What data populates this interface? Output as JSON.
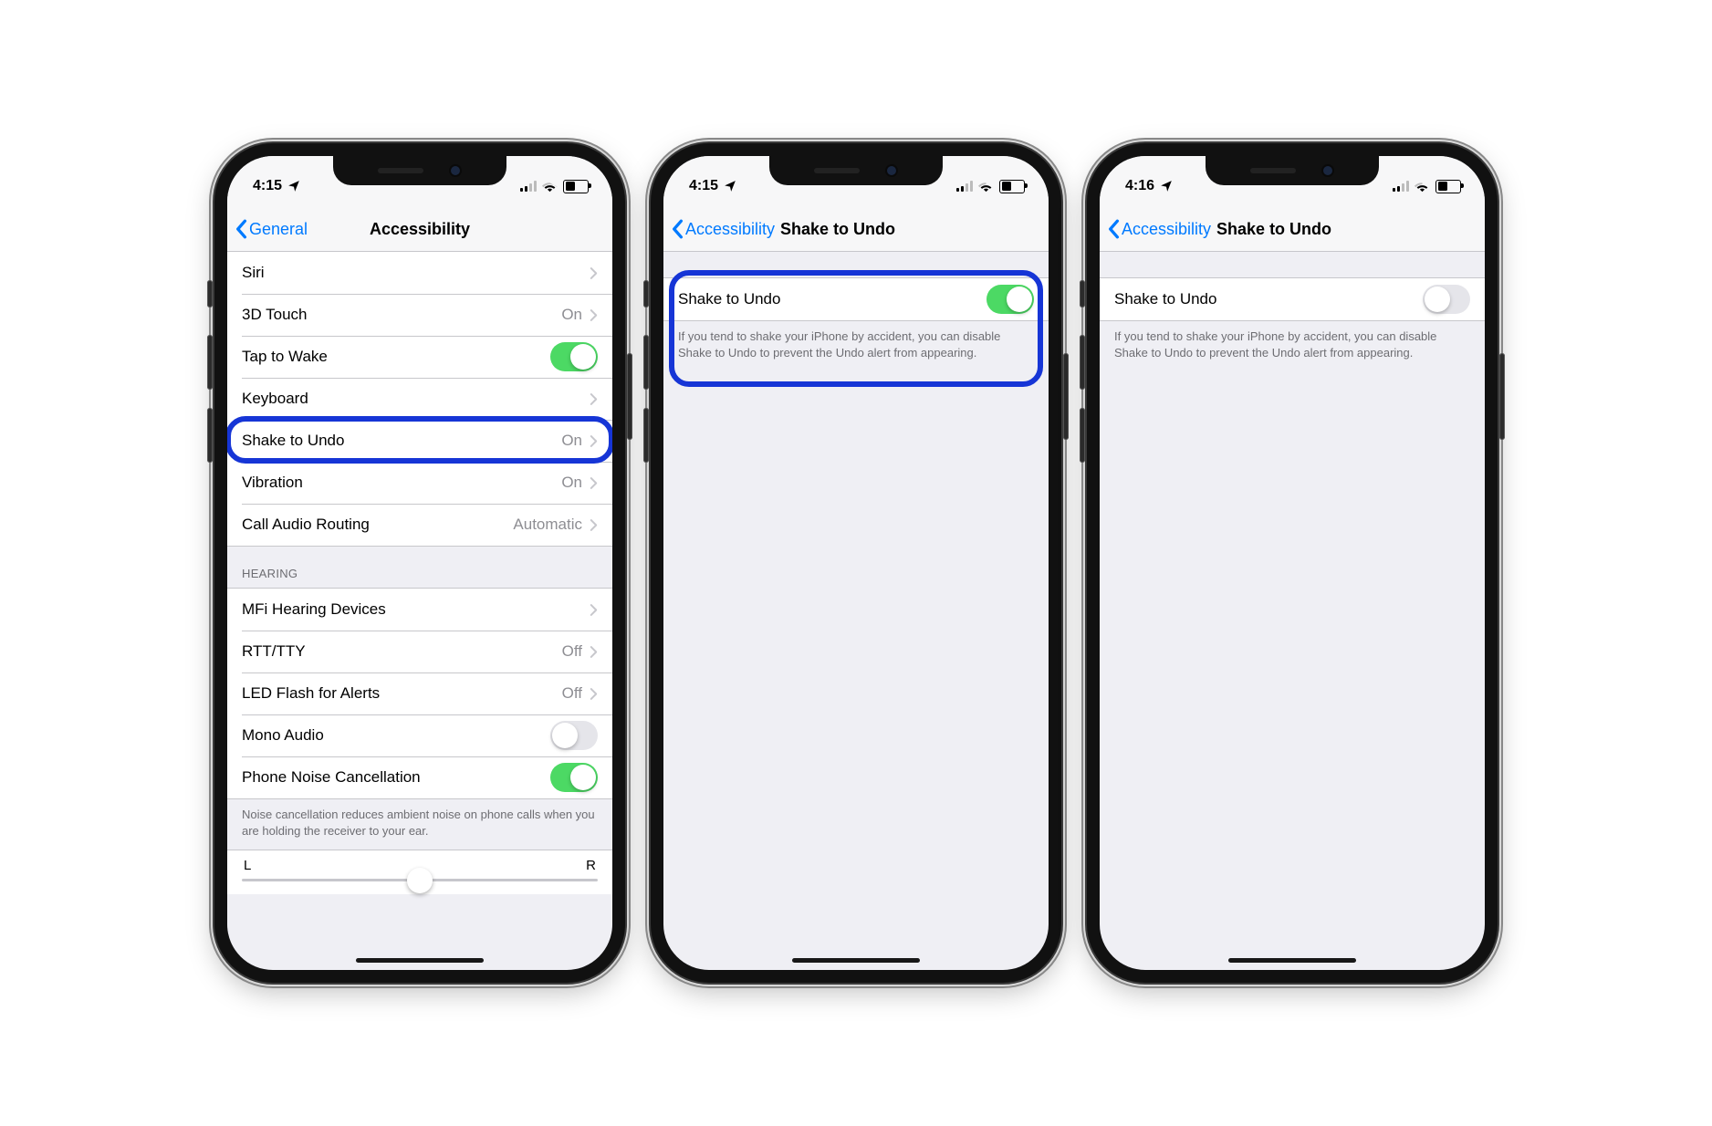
{
  "screens": [
    {
      "id": "accessibility",
      "time": "4:15",
      "back_label": "General",
      "title": "Accessibility",
      "title_centered": true,
      "highlight_label": "Shake to Undo",
      "interaction_sec": {
        "rows": [
          {
            "label": "Siri",
            "type": "disclosure",
            "value": ""
          },
          {
            "label": "3D Touch",
            "type": "disclosure",
            "value": "On"
          },
          {
            "label": "Tap to Wake",
            "type": "toggle",
            "on": true
          },
          {
            "label": "Keyboard",
            "type": "disclosure",
            "value": ""
          },
          {
            "label": "Shake to Undo",
            "type": "disclosure",
            "value": "On",
            "highlight": true
          },
          {
            "label": "Vibration",
            "type": "disclosure",
            "value": "On"
          },
          {
            "label": "Call Audio Routing",
            "type": "disclosure",
            "value": "Automatic"
          }
        ]
      },
      "hearing_sec": {
        "header": "HEARING",
        "rows": [
          {
            "label": "MFi Hearing Devices",
            "type": "disclosure",
            "value": ""
          },
          {
            "label": "RTT/TTY",
            "type": "disclosure",
            "value": "Off"
          },
          {
            "label": "LED Flash for Alerts",
            "type": "disclosure",
            "value": "Off"
          },
          {
            "label": "Mono Audio",
            "type": "toggle",
            "on": false
          },
          {
            "label": "Phone Noise Cancellation",
            "type": "toggle",
            "on": true
          }
        ],
        "footer": "Noise cancellation reduces ambient noise on phone calls when you are holding the receiver to your ear."
      },
      "balance": {
        "left_label": "L",
        "right_label": "R"
      }
    },
    {
      "id": "shake-on",
      "time": "4:15",
      "back_label": "Accessibility",
      "title": "Shake to Undo",
      "title_centered": false,
      "highlight": true,
      "toggle_label": "Shake to Undo",
      "toggle_on": true,
      "footer": "If you tend to shake your iPhone by accident, you can disable Shake to Undo to prevent the Undo alert from appearing."
    },
    {
      "id": "shake-off",
      "time": "4:16",
      "back_label": "Accessibility",
      "title": "Shake to Undo",
      "title_centered": false,
      "highlight": false,
      "toggle_label": "Shake to Undo",
      "toggle_on": false,
      "footer": "If you tend to shake your iPhone by accident, you can disable Shake to Undo to prevent the Undo alert from appearing."
    }
  ]
}
